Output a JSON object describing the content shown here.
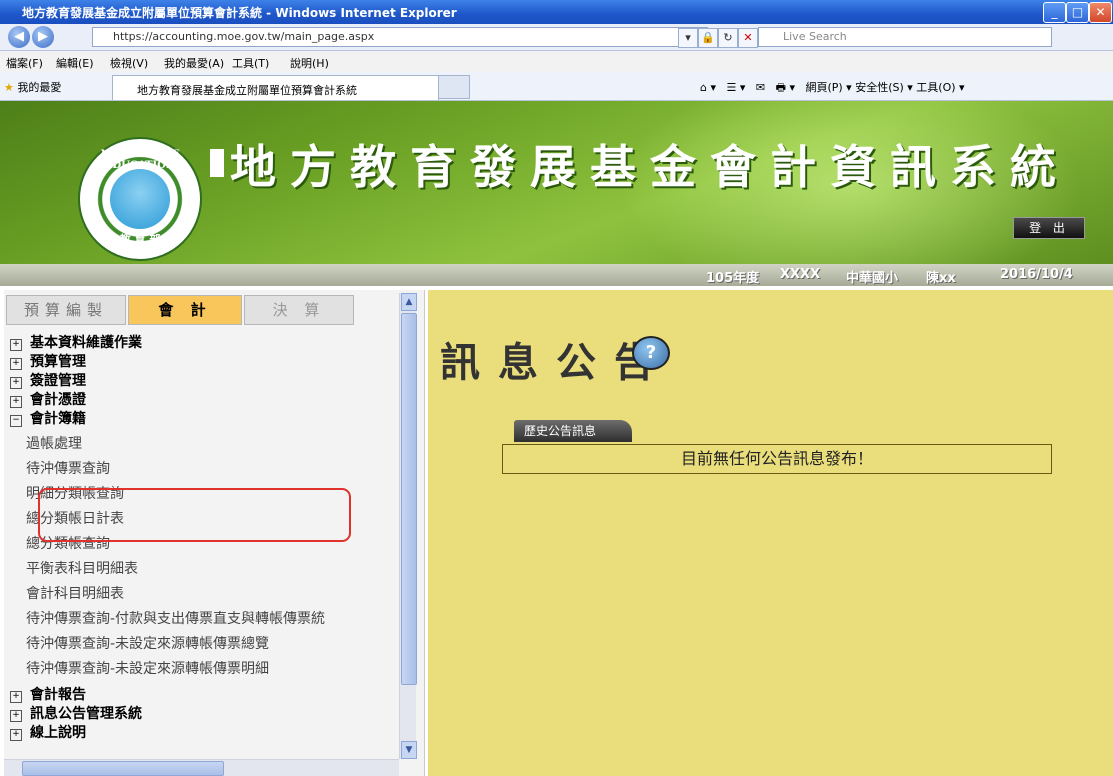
{
  "window": {
    "title": "地方教育發展基金成立附屬單位預算會計系統 - Windows Internet Explorer",
    "controls": [
      "_",
      "□",
      "X"
    ]
  },
  "address": {
    "url": "https://accounting.moe.gov.tw/main_page.aspx",
    "search_placeholder": "Live Search"
  },
  "menu": [
    "檔案(F)",
    "編輯(E)",
    "檢視(V)",
    "我的最愛(A)",
    "工具(T)",
    "說明(H)"
  ],
  "favorites": {
    "label": "我的最愛",
    "tab_title": "地方教育發展基金成立附屬單位預算會計系統",
    "tools": "網頁(P) ▾  安全性(S) ▾  工具(O) ▾"
  },
  "banner": {
    "title": "地方教育發展基金會計資訊系統",
    "logo_top": "MINISTRY OF EDUCATION",
    "logo_bottom": "教 育 部",
    "logout_label": "登 出"
  },
  "status": {
    "year": "105年度",
    "code": "XXXX",
    "unit": "中華國小",
    "user": "陳xx",
    "date": "2016/10/4"
  },
  "sidebar": {
    "tabs": [
      "預算編製",
      "會 計",
      "決 算"
    ],
    "tree_top": [
      "基本資料維護作業",
      "預算管理",
      "簽證管理",
      "會計憑證",
      "會計簿籍"
    ],
    "sub_items": [
      "過帳處理",
      "待沖傳票查詢",
      "明細分類帳查詢",
      "總分類帳日計表",
      "總分類帳查詢",
      "平衡表科目明細表",
      "會計科目明細表",
      "待沖傳票查詢-付款與支出傳票直支與轉帳傳票統",
      "待沖傳票查詢-未設定來源轉帳傳票總覽",
      "待沖傳票查詢-未設定來源轉帳傳票明細"
    ],
    "tree_bottom": [
      "會計報告",
      "訊息公告管理系統",
      "線上說明"
    ]
  },
  "main": {
    "heading": "訊息公告",
    "history_tab": "歷史公告訊息",
    "message": "目前無任何公告訊息發布！"
  }
}
